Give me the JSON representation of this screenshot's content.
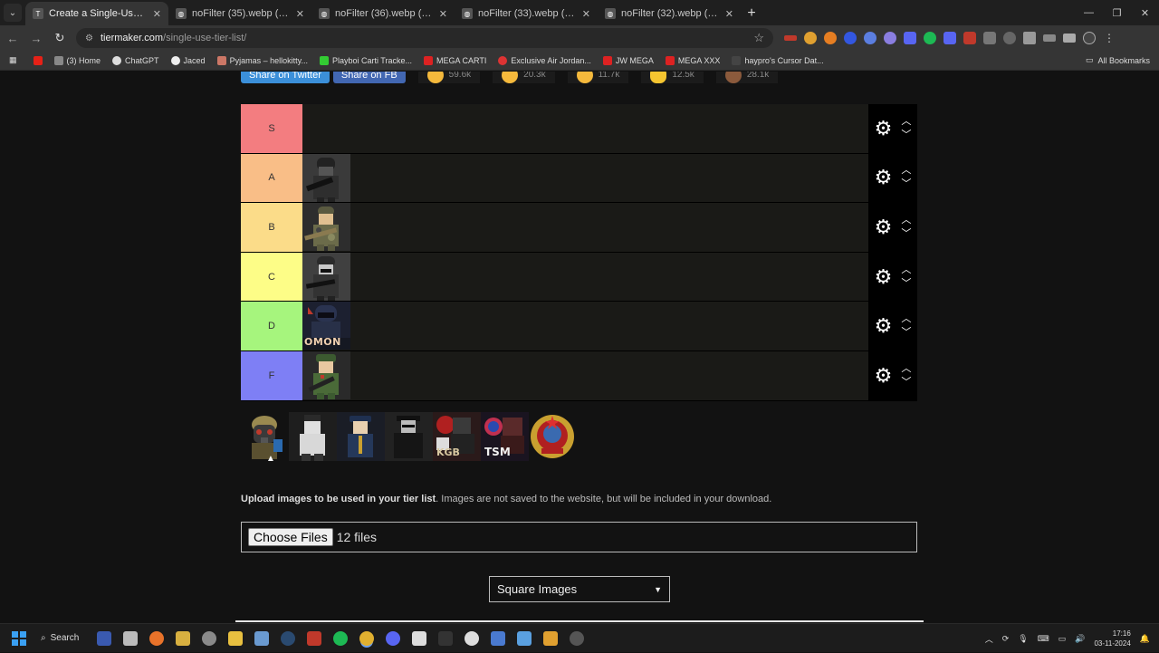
{
  "tabs": [
    {
      "title": "Create a Single-Use Tier List (P",
      "active": true
    },
    {
      "title": "noFilter (35).webp (150×150)",
      "active": false
    },
    {
      "title": "noFilter (36).webp (150×150)",
      "active": false
    },
    {
      "title": "noFilter (33).webp (147×150)",
      "active": false
    },
    {
      "title": "noFilter (32).webp (150×150)",
      "active": false
    }
  ],
  "address": {
    "host": "tiermaker.com",
    "path": "/single-use-tier-list/"
  },
  "bookmarks": [
    {
      "label": "",
      "color": "#e62117"
    },
    {
      "label": "(3) Home",
      "color": "#888"
    },
    {
      "label": "ChatGPT",
      "color": "#ddd"
    },
    {
      "label": "Jaced",
      "color": "#eee"
    },
    {
      "label": "Pyjamas – hellokitty...",
      "color": "#c76"
    },
    {
      "label": "Playboi Carti Tracke...",
      "color": "#3c3"
    },
    {
      "label": "MEGA CARTI",
      "color": "#d22"
    },
    {
      "label": "Exclusive Air Jordan...",
      "color": "#d33"
    },
    {
      "label": "JW MEGA",
      "color": "#d22"
    },
    {
      "label": "MEGA XXX",
      "color": "#d22"
    },
    {
      "label": "haypro's Cursor Dat...",
      "color": "#444"
    }
  ],
  "all_bookmarks": "All Bookmarks",
  "share": {
    "twitter": "Share on Twitter",
    "fb": "Share on FB"
  },
  "reactions": [
    "59.6k",
    "20.3k",
    "11.7k",
    "12.5k",
    "28.1k"
  ],
  "tiers": [
    {
      "label": "S",
      "color": "#f37d80",
      "items": []
    },
    {
      "label": "A",
      "color": "#f9be87",
      "items": [
        "soldier-gray"
      ]
    },
    {
      "label": "B",
      "color": "#fbdc89",
      "items": [
        "soldier-camo"
      ]
    },
    {
      "label": "C",
      "color": "#fdfd87",
      "items": [
        "soldier-gray"
      ]
    },
    {
      "label": "D",
      "color": "#a6f57d",
      "items": [
        "omon"
      ]
    },
    {
      "label": "F",
      "color": "#7e7ff5",
      "items": [
        "soldier-green"
      ]
    }
  ],
  "pool": [
    "gasmask",
    "civilian",
    "officer",
    "agent",
    "kgb",
    "tsm",
    "ussr-emblem"
  ],
  "omon_text": "OMON",
  "kgb_text": "KGB",
  "tsm_text": "TSM",
  "upload": {
    "bold": "Upload images to be used in your tier list",
    "rest": ". Images are not saved to the website, but will be included in your download.",
    "button": "Choose Files",
    "status": "12 files"
  },
  "select": {
    "value": "Square Images"
  },
  "taskbar": {
    "search": "Search",
    "time": "17:16",
    "date": "03-11-2024"
  }
}
